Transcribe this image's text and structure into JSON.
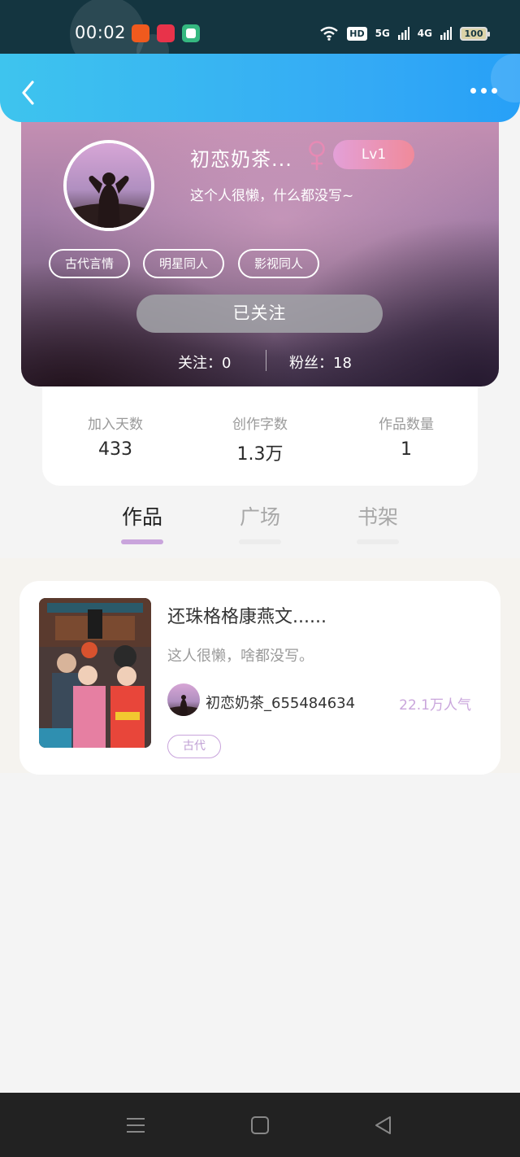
{
  "status_bar": {
    "time": "00:02",
    "net_5g": "5G",
    "net_4g": "4G",
    "hd": "HD",
    "battery": "100"
  },
  "profile": {
    "username": "初恋奶茶...",
    "level": "Lv1",
    "signature": "这个人很懒，什么都没写~",
    "tags": [
      "古代言情",
      "明星同人",
      "影视同人"
    ],
    "follow_button": "已关注",
    "following": "关注：0",
    "fans": "粉丝：18"
  },
  "stats": [
    {
      "label": "加入天数",
      "value": "433"
    },
    {
      "label": "创作字数",
      "value": "1.3万"
    },
    {
      "label": "作品数量",
      "value": "1"
    }
  ],
  "tabs": [
    {
      "label": "作品",
      "active": true
    },
    {
      "label": "广场",
      "active": false
    },
    {
      "label": "书架",
      "active": false
    }
  ],
  "works": [
    {
      "title": "还珠格格康燕文......",
      "description": "这人很懒，啥都没写。",
      "author": "初恋奶茶_655484634",
      "popularity": "22.1万人气",
      "genre": "古代"
    }
  ],
  "colors": {
    "header_blue": "#34aaf5",
    "tab_underline_active": "#c9a4dc",
    "tab_underline_inactive": "#ececec",
    "popularity": "#caa6dc",
    "female": "#e68ab4"
  },
  "icons": {
    "back": "chevron-left-icon",
    "more": "more-dots-icon",
    "gender": "female-icon",
    "nav_menu": "menu-icon",
    "nav_home": "home-square-icon",
    "nav_back": "back-triangle-icon"
  }
}
